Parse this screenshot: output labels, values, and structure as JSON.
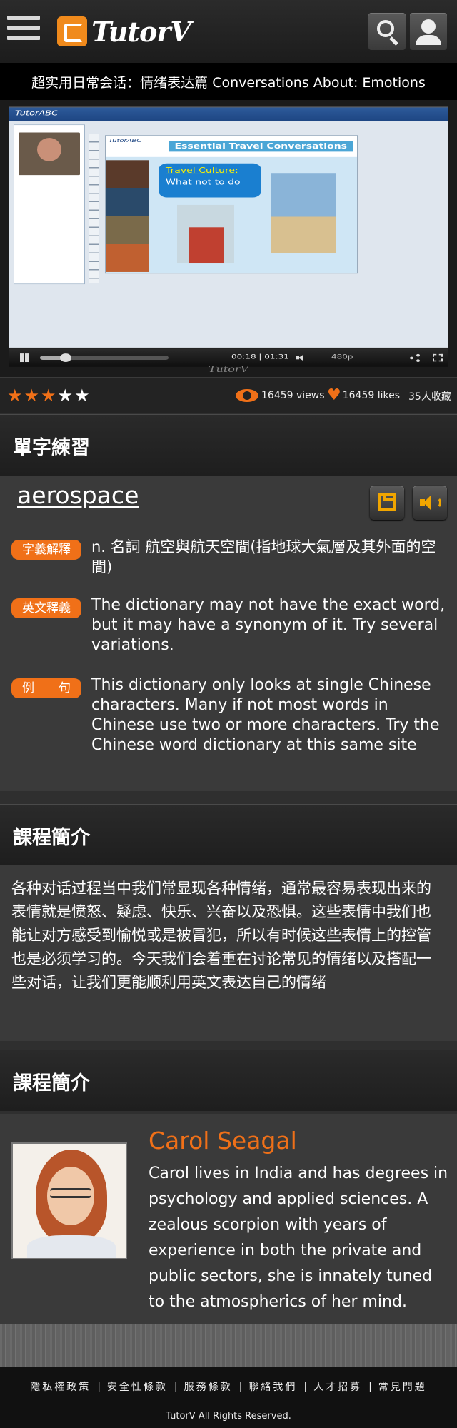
{
  "header": {
    "menu_icon": "hamburger-menu-icon",
    "logo_text": "TutorV",
    "search_icon": "search-icon",
    "user_icon": "user-icon"
  },
  "page_title": "超实用日常会话：情绪表达篇 Conversations About: Emotions",
  "video": {
    "app_brand": "TutorABC",
    "slide_brand": "TutorABC",
    "slide_title": "Essential Travel Conversations",
    "slide_bubble_line1": "Travel Culture:",
    "slide_bubble_line2": "What not to do",
    "time": "00:18 | 01:31",
    "quality": "480p",
    "progress_fraction": 0.2,
    "watermark": "TutorV"
  },
  "stats": {
    "rating": 3,
    "rating_max": 5,
    "views": "16459 views",
    "likes": "16459 likes",
    "favorites": "35人收藏"
  },
  "vocab_section": {
    "heading": "單字練習",
    "word": "aerospace",
    "rows": [
      {
        "tag": "字義解釋",
        "text": "n. 名詞   航空與航天空間(指地球大氣層及其外面的空間)"
      },
      {
        "tag": "英文釋義",
        "text": "The dictionary may not have the exact word, but it may have a synonym of it. Try several variations."
      },
      {
        "tag": "例　　句",
        "text": "This dictionary only looks at single Chinese characters. Many if not most words in Chinese use two or more characters. Try the Chinese word dictionary at this same site"
      }
    ]
  },
  "intro_section": {
    "heading": "課程簡介",
    "text": "各种对话过程当中我们常显现各种情绪，通常最容易表现出来的表情就是愤怒、疑虑、快乐、兴奋以及恐惧。这些表情中我们也能让对方感受到愉悦或是被冒犯，所以有时候这些表情上的控管也是必须学习的。今天我们会着重在讨论常见的情绪以及搭配一些对话，让我们更能顺利用英文表达自己的情绪"
  },
  "instructor_section": {
    "heading": "課程簡介",
    "name": "Carol Seagal",
    "bio": "Carol lives in India and has degrees in psychology and applied sciences. A zealous scorpion with years of experience in both the private and public sectors, she is innately tuned to the atmospherics of her mind."
  },
  "footer": {
    "links": [
      "隱私權政策",
      "安全性條款",
      "服務條款",
      "聯絡我們",
      "人才招募",
      "常見問題"
    ],
    "separator": "|",
    "copyright": "TutorV All Rights Reserved."
  },
  "colors": {
    "accent": "#f07018",
    "icon_gold": "#f0a500",
    "background": "#2f2f2f"
  }
}
